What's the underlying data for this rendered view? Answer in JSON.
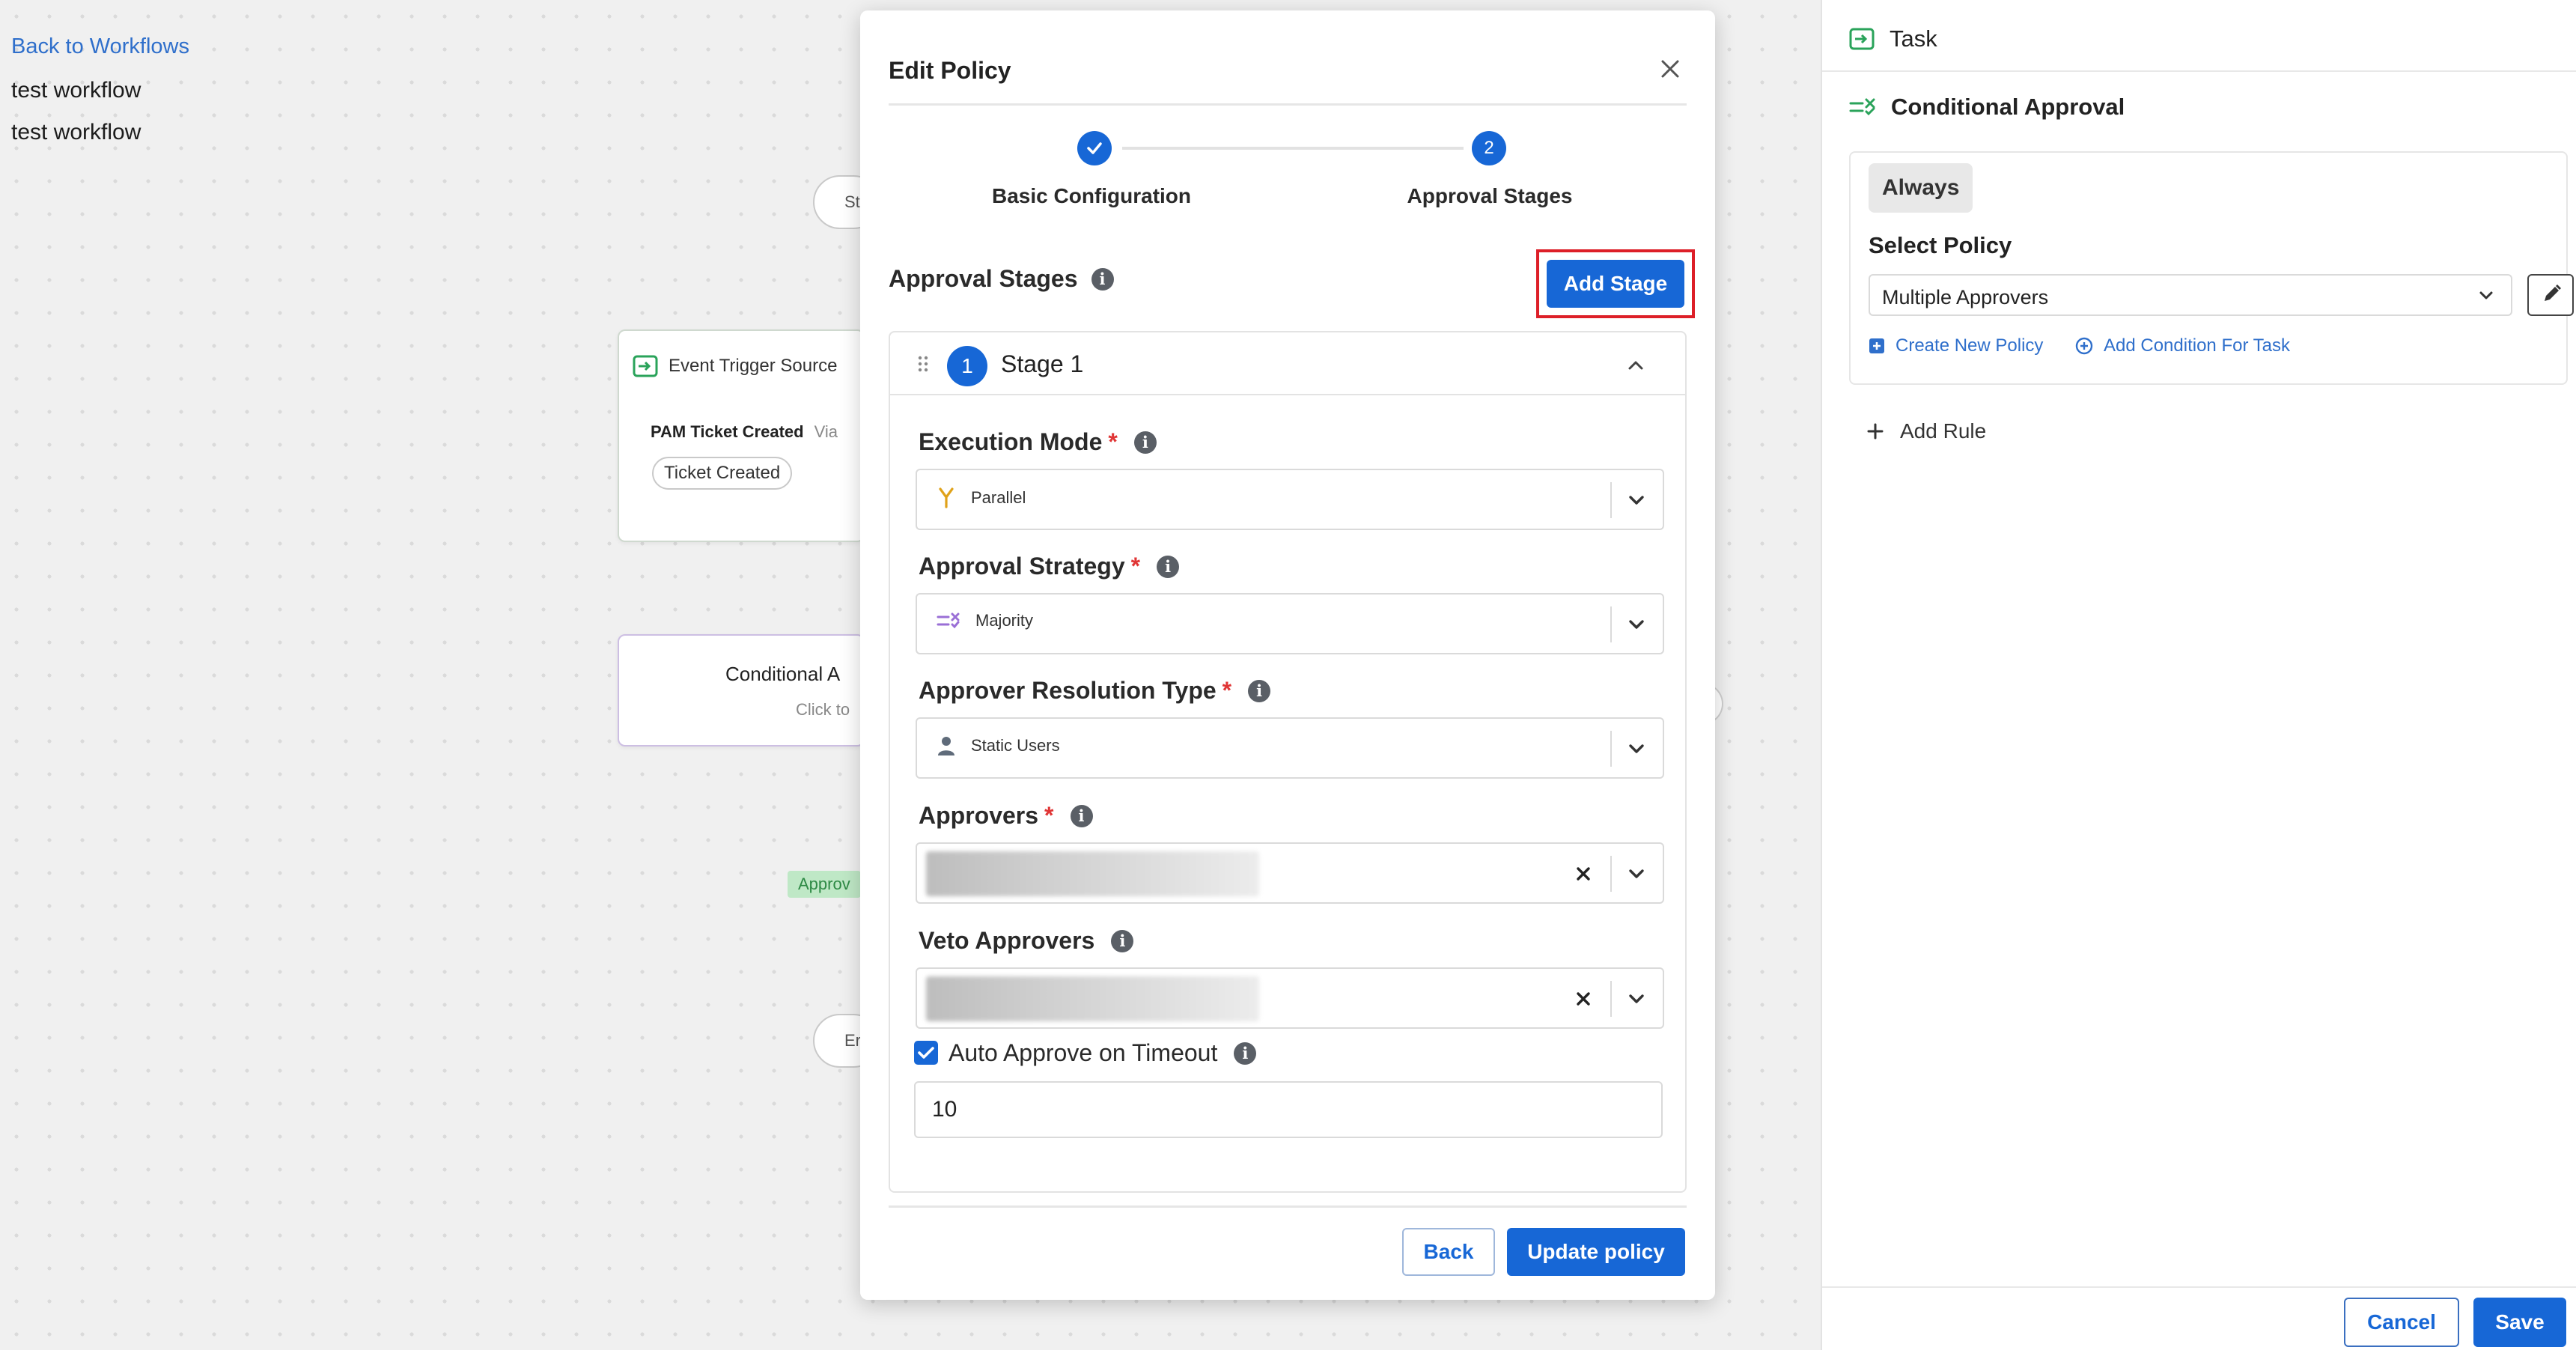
{
  "colors": {
    "primary": "#1767d6",
    "highlight": "#dd1f28",
    "link": "#2f6fcb",
    "required": "#e03535",
    "approve_tag_bg": "#bfe8c6"
  },
  "canvas": {
    "back_link": "Back to Workflows",
    "workflow_name": "test workflow",
    "workflow_desc": "test workflow",
    "start_node_label": "St",
    "end_node_label": "Er",
    "event_node": {
      "title": "Event Trigger Source",
      "event_name": "PAM Ticket Created",
      "via": "Via",
      "chip": "Ticket Created"
    },
    "conditional_node": {
      "title": "Conditional A",
      "subtitle": "Click to"
    },
    "approve_tag": "Approv"
  },
  "modal": {
    "title": "Edit Policy",
    "steps": [
      {
        "number": "",
        "label": "Basic Configuration",
        "done": true
      },
      {
        "number": "2",
        "label": "Approval Stages",
        "done": false
      }
    ],
    "section_title": "Approval Stages",
    "add_stage_label": "Add Stage",
    "stage": {
      "number": "1",
      "name": "Stage 1",
      "fields": {
        "execution_mode": {
          "label": "Execution Mode",
          "value": "Parallel",
          "icon": "fork-icon"
        },
        "approval_strategy": {
          "label": "Approval Strategy",
          "value": "Majority",
          "icon": "strategy-icon"
        },
        "approver_resolution": {
          "label": "Approver Resolution Type",
          "value": "Static Users",
          "icon": "user-icon"
        },
        "approvers": {
          "label": "Approvers"
        },
        "veto_approvers": {
          "label": "Veto Approvers"
        },
        "auto_approve": {
          "label": "Auto Approve on Timeout",
          "checked": true,
          "value": "10"
        }
      }
    },
    "back_label": "Back",
    "update_label": "Update policy"
  },
  "panel": {
    "task_label": "Task",
    "conditional_label": "Conditional Approval",
    "always_label": "Always",
    "select_policy_label": "Select Policy",
    "selected_policy": "Multiple Approvers",
    "create_policy_link": "Create New Policy",
    "add_condition_link": "Add Condition For Task",
    "add_rule_label": "Add Rule",
    "cancel_label": "Cancel",
    "save_label": "Save"
  }
}
